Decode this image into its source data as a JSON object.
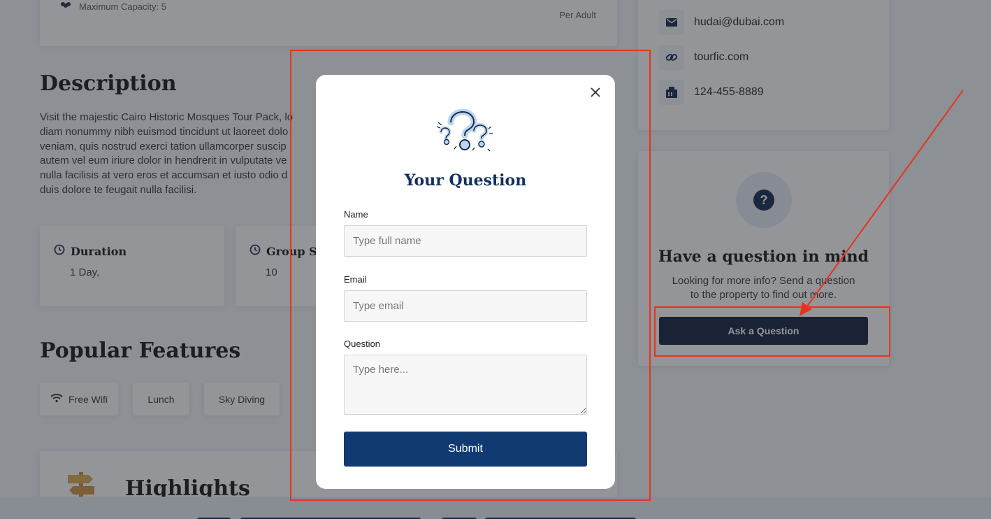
{
  "tour": {
    "capacity_label": "Maximum Capacity: 5",
    "price_unit": "Per Adult"
  },
  "description": {
    "title": "Description",
    "lines": [
      "Visit the majestic Cairo Historic Mosques Tour Pack, lo",
      "diam nonummy nibh euismod tincidunt ut laoreet dolo",
      "veniam, quis nostrud exerci tation ullamcorper suscip",
      "autem vel eum iriure dolor in hendrerit in vulputate ve",
      "nulla facilisis at vero eros et accumsan et iusto odio d",
      "duis dolore te feugait nulla facilisi."
    ]
  },
  "info_cards": [
    {
      "label": "Duration",
      "value": "1 Day,"
    },
    {
      "label": "Group Siz",
      "value": "10"
    }
  ],
  "features": {
    "title": "Popular Features",
    "items": [
      "Free Wifi",
      "Lunch",
      "Sky Diving"
    ]
  },
  "highlights": {
    "title": "Highlights"
  },
  "contact": {
    "email": "hudai@dubai.com",
    "website": "tourfic.com",
    "phone": "124-455-8889"
  },
  "ask_card": {
    "title": "Have a question in mind",
    "text_line1": "Looking for more info? Send a question",
    "text_line2": "to the property to find out more.",
    "button_label": "Ask a Question"
  },
  "modal": {
    "title": "Your Question",
    "name_label": "Name",
    "name_placeholder": "Type full name",
    "email_label": "Email",
    "email_placeholder": "Type email",
    "question_label": "Question",
    "question_placeholder": "Type here...",
    "submit_label": "Submit"
  },
  "colors": {
    "primary_navy": "#0d1b36",
    "submit_blue": "#113a73",
    "title_blue": "#12305f",
    "annotation_red": "#e8321e"
  },
  "icons": [
    "users-icon",
    "clock-icon",
    "wifi-icon",
    "signpost-icon",
    "envelope-icon",
    "link-icon",
    "fax-icon",
    "question-icon",
    "close-icon",
    "question-marks-illustration"
  ]
}
